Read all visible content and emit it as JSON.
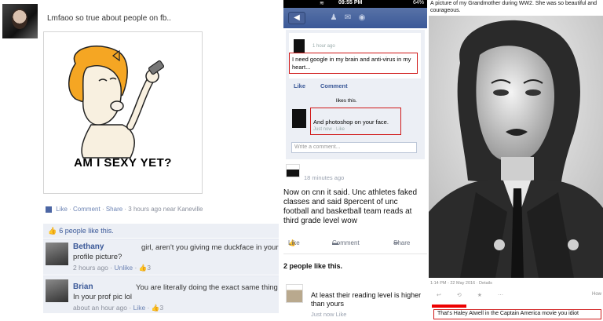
{
  "left_post": {
    "status_text": "Lmfaoo so true about people on fb..",
    "meme_caption": "AM I SEXY YET?",
    "actions": {
      "like": "Like",
      "comment": "Comment",
      "share": "Share",
      "time": "3 hours ago near Kaneville"
    },
    "likes_count_text": "6 people like this.",
    "comments": [
      {
        "name": "Bethany",
        "text_right": "girl, aren't you giving me duckface in your",
        "text_second": "profile picture?",
        "time": "2 hours ago",
        "action": "Unlike",
        "likes": "3"
      },
      {
        "name": "Brian",
        "text_right": "You are literally doing the exact same thing",
        "text_second": "In your prof pic lol",
        "time": "about an hour ago",
        "action": "Like",
        "likes": "3"
      }
    ]
  },
  "middle_post": {
    "statusbar": {
      "time": "09:55 PM",
      "battery": "64%"
    },
    "post_time": "1 hour ago",
    "post_text": "I need google in my brain and anti-virus in my heart...",
    "like_label": "Like",
    "comment_label": "Comment",
    "likes_this": "likes this.",
    "reply_text": "And photoshop on your face.",
    "reply_meta": "Just now · Like",
    "comment_placeholder": "Write a comment...",
    "second_time": "18 minutes ago",
    "second_body": "Now on cnn it said. Unc athletes faked classes and said 8percent of unc football and basketball team reads at third grade level wow",
    "actions": {
      "like": "Like",
      "comment": "Comment",
      "share": "Share"
    },
    "people_like": "2 people like this.",
    "reply2_text": "At least their reading level is higher than yours",
    "reply2_meta": "Just now   Like"
  },
  "right_post": {
    "caption": "A picture of my Grandmother during WW2. She was so beautiful and courageous.",
    "meta": "1:14 PM - 22 May 2016 · Details",
    "how": "How",
    "reply": "That's Haley Atwell in the Captain America movie you idiot"
  }
}
